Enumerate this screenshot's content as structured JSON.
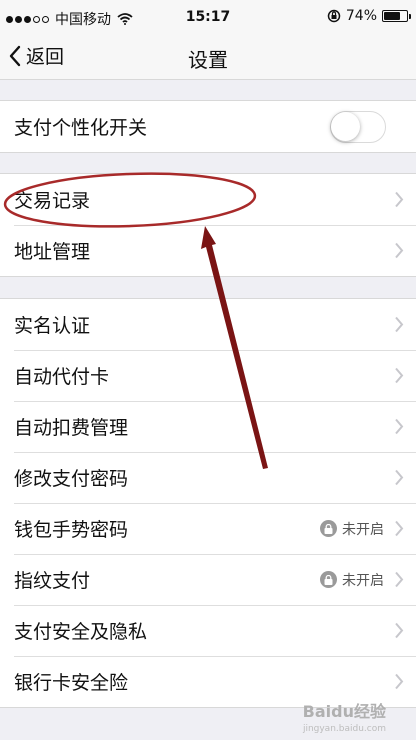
{
  "status_bar": {
    "carrier": "中国移动",
    "time": "15:17",
    "battery_text": "74%",
    "battery_level": 0.74,
    "signal_bars_filled": 3,
    "signal_bars_total": 5
  },
  "nav": {
    "back_label": "返回",
    "title": "设置"
  },
  "groups": {
    "g1": {
      "rows": [
        {
          "label": "支付个性化开关",
          "toggle_on": false
        }
      ]
    },
    "g2": {
      "rows": [
        {
          "label": "交易记录"
        },
        {
          "label": "地址管理"
        }
      ]
    },
    "g3": {
      "rows": [
        {
          "label": "实名认证"
        },
        {
          "label": "自动代付卡"
        },
        {
          "label": "自动扣费管理"
        },
        {
          "label": "修改支付密码"
        },
        {
          "label": "钱包手势密码",
          "status": "未开启"
        },
        {
          "label": "指纹支付",
          "status": "未开启"
        },
        {
          "label": "支付安全及隐私"
        },
        {
          "label": "银行卡安全险"
        }
      ]
    }
  },
  "watermark": {
    "text": "Baidu经验",
    "sub": "jingyan.baidu.com"
  },
  "colors": {
    "annotation": "#8b1a1a",
    "background": "#efeff4"
  },
  "icons": [
    "wifi-icon",
    "lock-rotation-icon",
    "back-chevron-icon",
    "chevron-right-icon",
    "lock-icon"
  ]
}
